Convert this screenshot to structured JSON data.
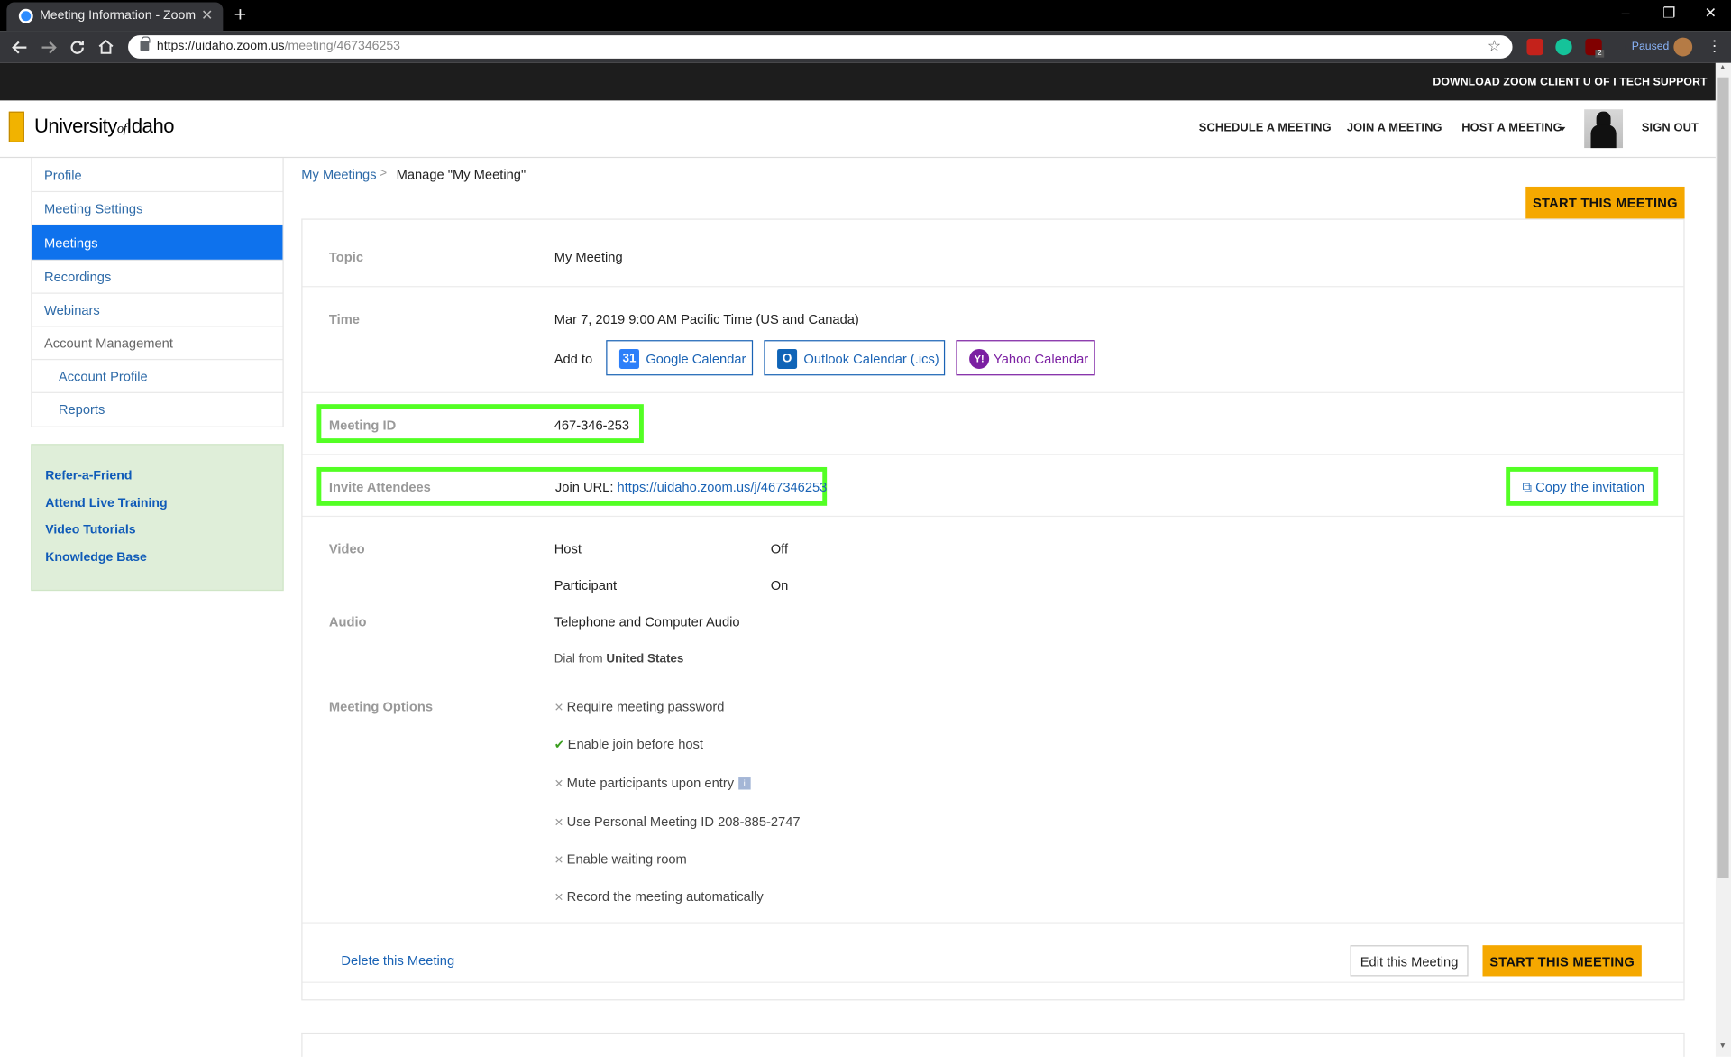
{
  "browser": {
    "tab_title": "Meeting Information - Zoom",
    "tab_close": "✕",
    "new_tab": "+",
    "url_host": "https://uidaho.zoom.us",
    "url_path": "/meeting/467346253",
    "paused_label": "Paused",
    "window_controls": [
      "–",
      "❐",
      "✕"
    ],
    "nav_icons": [
      "back-arrow-icon",
      "forward-arrow-icon",
      "reload-icon",
      "home-icon"
    ],
    "extensions": [
      "pdf-icon",
      "grammarly-icon",
      "ublock-icon"
    ],
    "ext_badge": "2"
  },
  "topbar": {
    "download_client": "DOWNLOAD ZOOM CLIENT",
    "tech_support": "U OF I TECH SUPPORT"
  },
  "header": {
    "logo_part1": "University",
    "logo_of": "of",
    "logo_part2": "Idaho",
    "schedule": "SCHEDULE A MEETING",
    "join": "JOIN A MEETING",
    "host": "HOST A MEETING",
    "sign_out": "SIGN OUT"
  },
  "sidebar": {
    "items": [
      {
        "label": "Profile"
      },
      {
        "label": "Meeting Settings"
      },
      {
        "label": "Meetings"
      },
      {
        "label": "Recordings"
      },
      {
        "label": "Webinars"
      },
      {
        "label": "Account Management"
      },
      {
        "label": "Account Profile"
      },
      {
        "label": "Reports"
      }
    ],
    "active_color": "#0e72ed",
    "promo": [
      {
        "label": "Refer-a-Friend"
      },
      {
        "label": "Attend Live Training"
      },
      {
        "label": "Video Tutorials"
      },
      {
        "label": "Knowledge Base"
      }
    ]
  },
  "breadcrumb": {
    "parent": "My Meetings",
    "separator": ">",
    "current": "Manage \"My Meeting\""
  },
  "meeting": {
    "start_label": "START THIS MEETING",
    "topic_label": "Topic",
    "topic": "My Meeting",
    "time_label": "Time",
    "time": "Mar 7, 2019 9:00 AM Pacific Time (US and Canada)",
    "add_to": "Add to",
    "calendars": {
      "google": {
        "label": "Google Calendar",
        "icon": "31"
      },
      "outlook": {
        "label": "Outlook Calendar (.ics)",
        "icon": "O"
      },
      "yahoo": {
        "label": "Yahoo Calendar",
        "icon": "Y!"
      }
    },
    "id_label": "Meeting ID",
    "id": "467-346-253",
    "invite_label": "Invite Attendees",
    "join_url_label": "Join URL:",
    "join_url": "https://uidaho.zoom.us/j/467346253",
    "copy_invitation": "Copy the invitation",
    "video_label": "Video",
    "host_label": "Host",
    "host_video": "Off",
    "participant_label": "Participant",
    "participant_video": "On",
    "audio_label": "Audio",
    "audio": "Telephone and Computer Audio",
    "dial_from": "Dial from",
    "dial_country": "United States",
    "options_label": "Meeting Options",
    "options": [
      {
        "text": "Require meeting password",
        "enabled": false
      },
      {
        "text": "Enable join before host",
        "enabled": true
      },
      {
        "text": "Mute participants upon entry",
        "enabled": false
      },
      {
        "text": "Use Personal Meeting ID 208-885-2747",
        "enabled": false
      },
      {
        "text": "Enable waiting room",
        "enabled": false
      },
      {
        "text": "Record the meeting automatically",
        "enabled": false
      }
    ],
    "delete_label": "Delete this Meeting",
    "edit_label": "Edit this Meeting",
    "highlight_color": "#53ff24",
    "accent_color": "#f5a800"
  }
}
